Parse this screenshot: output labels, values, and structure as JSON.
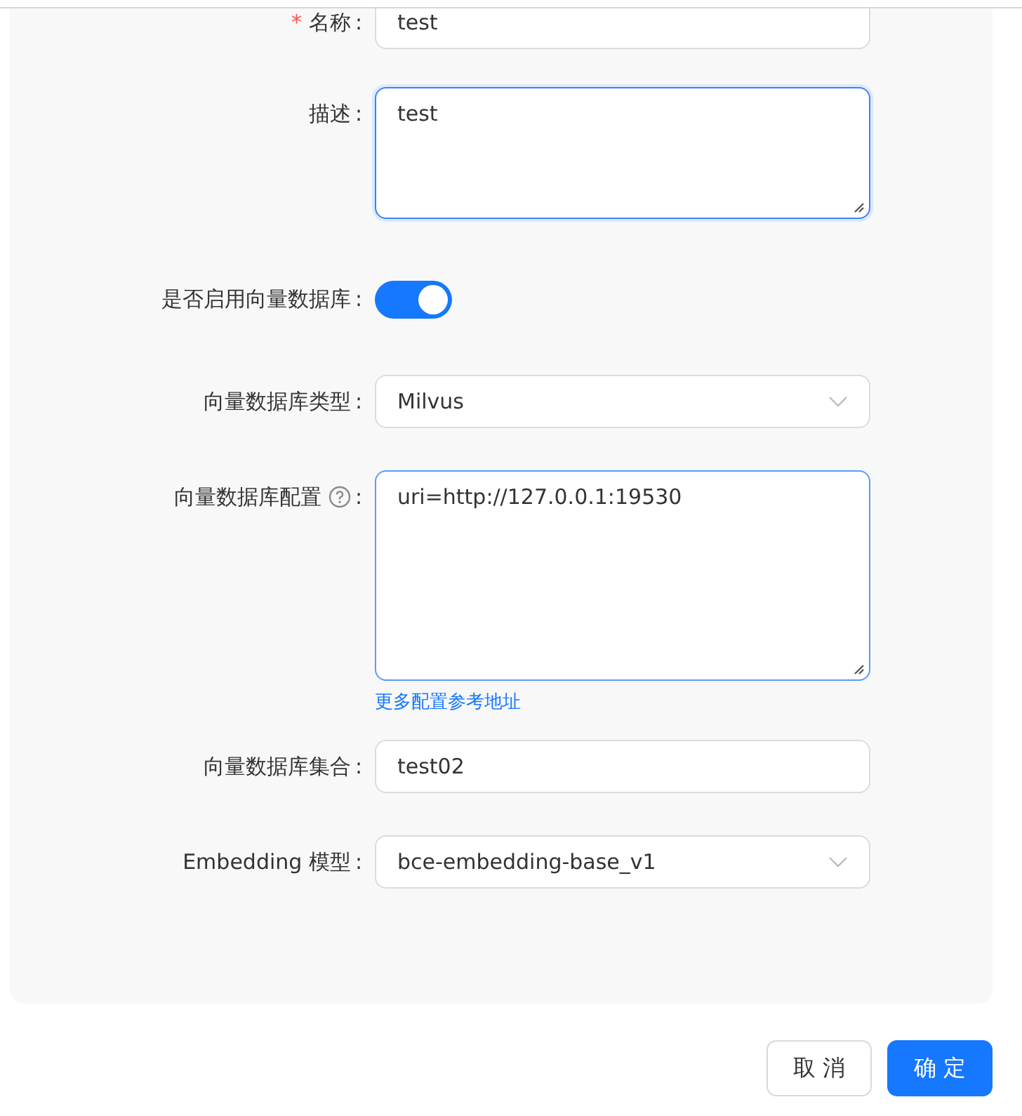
{
  "form": {
    "fields": [
      {
        "kind": "input",
        "label": "名称",
        "colon": ":",
        "required_mark": "*",
        "value": "test"
      },
      {
        "kind": "textarea",
        "label": "描述",
        "colon": ":",
        "value": "test",
        "focused": true
      },
      {
        "kind": "switch",
        "label": "是否启用向量数据库",
        "colon": ":",
        "on": true
      },
      {
        "kind": "select",
        "label": "向量数据库类型",
        "colon": ":",
        "value": "Milvus"
      },
      {
        "kind": "textarea",
        "label": "向量数据库配置",
        "colon": ":",
        "help": true,
        "value": "uri=http://127.0.0.1:19530",
        "focused": false,
        "link": "更多配置参考地址"
      },
      {
        "kind": "input",
        "label": "向量数据库集合",
        "colon": ":",
        "value": "test02"
      },
      {
        "kind": "select",
        "label": "Embedding 模型",
        "colon": ":",
        "value": "bce-embedding-base_v1"
      }
    ]
  },
  "buttons": [
    {
      "label": "取 消",
      "primary": false
    },
    {
      "label": "确 定",
      "primary": true
    }
  ]
}
